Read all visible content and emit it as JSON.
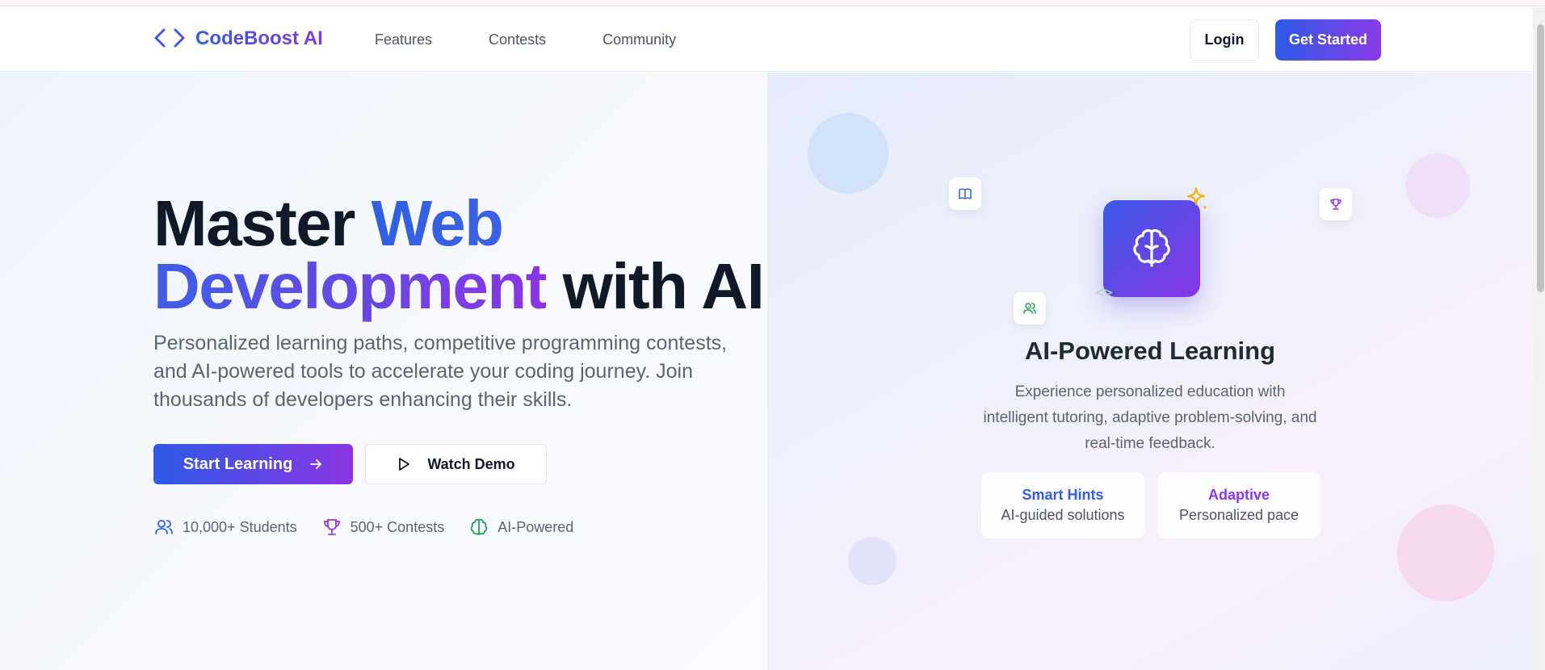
{
  "navbar": {
    "brand": "CodeBoost AI",
    "links": [
      "Features",
      "Contests",
      "Community"
    ],
    "login_label": "Login",
    "cta_label": "Get Started"
  },
  "hero": {
    "headline": {
      "part1": "Master ",
      "part2": "Web",
      "part3": "Development",
      "part4": " with AI"
    },
    "subtitle": "Personalized learning paths, competitive programming contests, and AI-powered tools to accelerate your coding journey. Join thousands of developers enhancing their skills.",
    "primary_button": "Start Learning",
    "secondary_button": "Watch Demo",
    "stats": [
      {
        "icon": "users-icon",
        "label": "10,000+ Students"
      },
      {
        "icon": "trophy-icon",
        "label": "500+ Contests"
      },
      {
        "icon": "brain-icon",
        "label": "AI-Powered"
      }
    ]
  },
  "feature_card": {
    "title": "AI-Powered Learning",
    "description": "Experience personalized education with intelligent tutoring, adaptive problem-solving, and real-time feedback.",
    "boxes": [
      {
        "title": "Smart Hints",
        "subtitle": "AI-guided solutions",
        "color": "#2f5fe3"
      },
      {
        "title": "Adaptive",
        "subtitle": "Personalized pace",
        "color": "#9333ea"
      }
    ]
  },
  "colors": {
    "accent_blue": "#2f5fe3",
    "accent_purple": "#8a34e3",
    "icon_green": "#16a34a"
  }
}
